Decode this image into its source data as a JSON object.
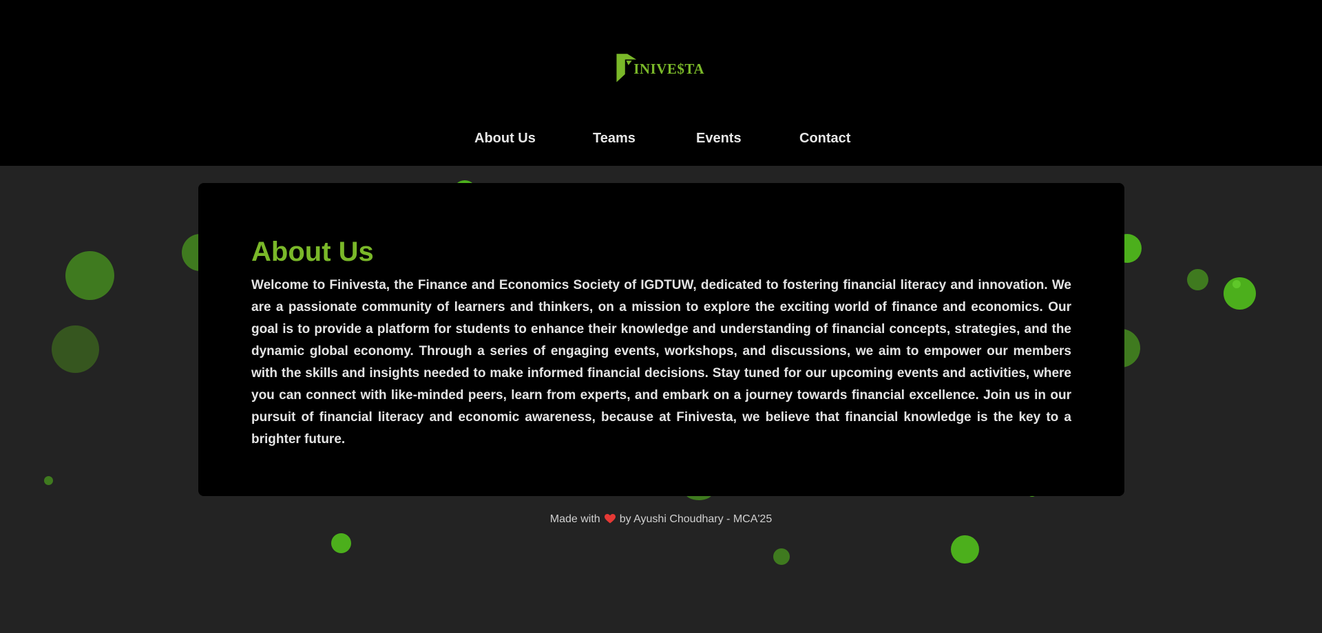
{
  "brand": {
    "logo_text": "INIVE$TA",
    "accent_color": "#7ab829"
  },
  "nav": {
    "items": [
      {
        "label": "About Us"
      },
      {
        "label": "Teams"
      },
      {
        "label": "Events"
      },
      {
        "label": "Contact"
      }
    ]
  },
  "about": {
    "title": "About Us",
    "body": "Welcome to Finivesta, the Finance and Economics Society of IGDTUW, dedicated to fostering financial literacy and innovation. We are a passionate community of learners and thinkers, on a mission to explore the exciting world of finance and economics. Our goal is to provide a platform for students to enhance their knowledge and understanding of financial concepts, strategies, and the dynamic global economy. Through a series of engaging events, workshops, and discussions, we aim to empower our members with the skills and insights needed to make informed financial decisions. Stay tuned for our upcoming events and activities, where you can connect with like-minded peers, learn from experts, and embark on a journey towards financial excellence. Join us in our pursuit of financial literacy and economic awareness, because at Finivesta, we believe that financial knowledge is the key to a brighter future."
  },
  "footer": {
    "prefix": "Made with",
    "icon": "heart-icon",
    "suffix": "by Ayushi Choudhary - MCA'25"
  },
  "colors": {
    "page_background": "#232323",
    "header_background": "#000000",
    "card_background": "#000000",
    "bubble_green": "#4caf1c",
    "bubble_dark_green": "#3a5a25"
  }
}
